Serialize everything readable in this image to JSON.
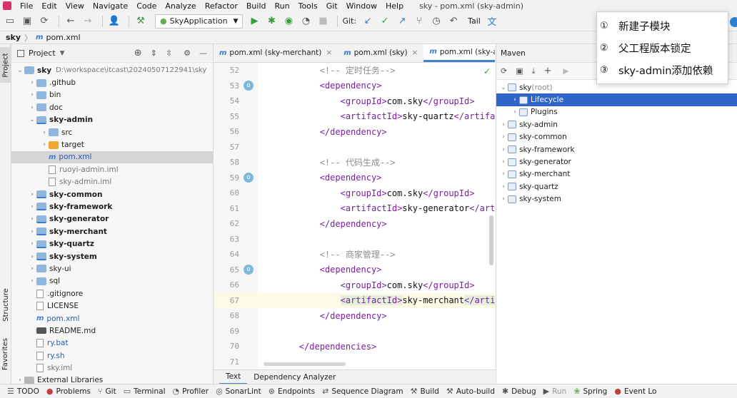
{
  "window": {
    "title": "sky - pom.xml (sky-admin)"
  },
  "menu": [
    "File",
    "Edit",
    "View",
    "Navigate",
    "Code",
    "Analyze",
    "Refactor",
    "Build",
    "Run",
    "Tools",
    "Git",
    "Window",
    "Help"
  ],
  "toolbar": {
    "run_config": "SkyApplication",
    "git_label": "Git:",
    "tail_label": "Tail"
  },
  "breadcrumb": {
    "project": "sky",
    "file": "pom.xml"
  },
  "left_tabs": {
    "project": "Project",
    "structure": "Structure",
    "favorites": "Favorites"
  },
  "project_panel": {
    "title": "Project",
    "root": {
      "name": "sky",
      "path": "D:\\workspace\\itcast\\20240507122941\\sky"
    },
    "items": [
      {
        "label": ".github",
        "type": "folder",
        "depth": 1,
        "expand": "closed"
      },
      {
        "label": "bin",
        "type": "folder",
        "depth": 1,
        "expand": "closed"
      },
      {
        "label": "doc",
        "type": "folder",
        "depth": 1,
        "expand": "closed"
      },
      {
        "label": "sky-admin",
        "type": "module",
        "depth": 1,
        "expand": "open",
        "bold": true
      },
      {
        "label": "src",
        "type": "folder",
        "depth": 2,
        "expand": "closed"
      },
      {
        "label": "target",
        "type": "folder-orange",
        "depth": 2,
        "expand": "closed"
      },
      {
        "label": "pom.xml",
        "type": "maven",
        "depth": 2,
        "expand": "none",
        "selected": true
      },
      {
        "label": "ruoyi-admin.iml",
        "type": "file",
        "depth": 2,
        "expand": "none",
        "muted": true
      },
      {
        "label": "sky-admin.iml",
        "type": "file",
        "depth": 2,
        "expand": "none",
        "muted": true
      },
      {
        "label": "sky-common",
        "type": "module",
        "depth": 1,
        "expand": "closed",
        "bold": true
      },
      {
        "label": "sky-framework",
        "type": "module",
        "depth": 1,
        "expand": "closed",
        "bold": true
      },
      {
        "label": "sky-generator",
        "type": "module",
        "depth": 1,
        "expand": "closed",
        "bold": true
      },
      {
        "label": "sky-merchant",
        "type": "module",
        "depth": 1,
        "expand": "closed",
        "bold": true
      },
      {
        "label": "sky-quartz",
        "type": "module",
        "depth": 1,
        "expand": "closed",
        "bold": true
      },
      {
        "label": "sky-system",
        "type": "module",
        "depth": 1,
        "expand": "closed",
        "bold": true
      },
      {
        "label": "sky-ui",
        "type": "folder",
        "depth": 1,
        "expand": "closed"
      },
      {
        "label": "sql",
        "type": "folder",
        "depth": 1,
        "expand": "closed"
      },
      {
        "label": ".gitignore",
        "type": "file",
        "depth": 1,
        "expand": "none"
      },
      {
        "label": "LICENSE",
        "type": "file",
        "depth": 1,
        "expand": "none"
      },
      {
        "label": "pom.xml",
        "type": "maven",
        "depth": 1,
        "expand": "none"
      },
      {
        "label": "README.md",
        "type": "md",
        "depth": 1,
        "expand": "none"
      },
      {
        "label": "ry.bat",
        "type": "file",
        "depth": 1,
        "expand": "none",
        "blue": true
      },
      {
        "label": "ry.sh",
        "type": "file",
        "depth": 1,
        "expand": "none",
        "blue": true
      },
      {
        "label": "sky.iml",
        "type": "file",
        "depth": 1,
        "expand": "none",
        "muted": true
      },
      {
        "label": "External Libraries",
        "type": "lib",
        "depth": 0,
        "expand": "closed"
      }
    ]
  },
  "editor": {
    "tabs": [
      {
        "label": "pom.xml (sky-merchant)",
        "active": false
      },
      {
        "label": "pom.xml (sky)",
        "active": false
      },
      {
        "label": "pom.xml (sky-admin)",
        "active": true
      }
    ],
    "lines": [
      {
        "n": "52",
        "parts": [
          [
            "cm",
            "            <!-- 定时任务-->"
          ]
        ]
      },
      {
        "n": "53",
        "mark": true,
        "parts": [
          [
            "tx",
            "            "
          ],
          [
            "tg",
            "<dependency>"
          ]
        ]
      },
      {
        "n": "54",
        "parts": [
          [
            "tx",
            "                "
          ],
          [
            "tg",
            "<groupId>"
          ],
          [
            "tx",
            "com.sky"
          ],
          [
            "tg",
            "</groupId>"
          ]
        ]
      },
      {
        "n": "55",
        "parts": [
          [
            "tx",
            "                "
          ],
          [
            "tg",
            "<artifactId>"
          ],
          [
            "tx",
            "sky-quartz"
          ],
          [
            "tg",
            "</artifactId>"
          ]
        ]
      },
      {
        "n": "56",
        "parts": [
          [
            "tx",
            "            "
          ],
          [
            "tg",
            "</dependency>"
          ]
        ]
      },
      {
        "n": "57",
        "parts": []
      },
      {
        "n": "58",
        "parts": [
          [
            "cm",
            "            <!-- 代码生成-->"
          ]
        ]
      },
      {
        "n": "59",
        "mark": true,
        "parts": [
          [
            "tx",
            "            "
          ],
          [
            "tg",
            "<dependency>"
          ]
        ]
      },
      {
        "n": "60",
        "parts": [
          [
            "tx",
            "                "
          ],
          [
            "tg",
            "<groupId>"
          ],
          [
            "tx",
            "com.sky"
          ],
          [
            "tg",
            "</groupId>"
          ]
        ]
      },
      {
        "n": "61",
        "parts": [
          [
            "tx",
            "                "
          ],
          [
            "tg",
            "<artifactId>"
          ],
          [
            "tx",
            "sky-generator"
          ],
          [
            "tg",
            "</artifactId>"
          ]
        ]
      },
      {
        "n": "62",
        "parts": [
          [
            "tx",
            "            "
          ],
          [
            "tg",
            "</dependency>"
          ]
        ]
      },
      {
        "n": "63",
        "parts": []
      },
      {
        "n": "64",
        "parts": [
          [
            "cm",
            "            <!-- 商家管理-->"
          ]
        ]
      },
      {
        "n": "65",
        "mark": true,
        "parts": [
          [
            "tx",
            "            "
          ],
          [
            "tg",
            "<dependency>"
          ]
        ]
      },
      {
        "n": "66",
        "parts": [
          [
            "tx",
            "                "
          ],
          [
            "tg",
            "<groupId>"
          ],
          [
            "tx",
            "com.sky"
          ],
          [
            "tg",
            "</groupId>"
          ]
        ]
      },
      {
        "n": "67",
        "hl": true,
        "parts": [
          [
            "tx",
            "                "
          ],
          [
            "tg",
            "<artifactId>"
          ],
          [
            "tx",
            "sky-merchant"
          ],
          [
            "tg",
            "</artifactId>"
          ]
        ]
      },
      {
        "n": "68",
        "parts": [
          [
            "tx",
            "            "
          ],
          [
            "tg",
            "</dependency>"
          ]
        ]
      },
      {
        "n": "69",
        "parts": []
      },
      {
        "n": "70",
        "parts": [
          [
            "tx",
            "        "
          ],
          [
            "tg",
            "</dependencies>"
          ]
        ]
      },
      {
        "n": "71",
        "parts": []
      }
    ],
    "bottom_tabs": [
      "Text",
      "Dependency Analyzer"
    ]
  },
  "maven": {
    "title": "Maven",
    "tree": [
      {
        "label": "sky",
        "suffix": " (root)",
        "depth": 0,
        "expand": "open",
        "kind": "module"
      },
      {
        "label": "Lifecycle",
        "depth": 1,
        "expand": "closed",
        "kind": "folder",
        "selected": true
      },
      {
        "label": "Plugins",
        "depth": 1,
        "expand": "closed",
        "kind": "folder"
      },
      {
        "label": "sky-admin",
        "depth": 0,
        "expand": "closed",
        "kind": "module"
      },
      {
        "label": "sky-common",
        "depth": 0,
        "expand": "closed",
        "kind": "module"
      },
      {
        "label": "sky-framework",
        "depth": 0,
        "expand": "closed",
        "kind": "module"
      },
      {
        "label": "sky-generator",
        "depth": 0,
        "expand": "closed",
        "kind": "module"
      },
      {
        "label": "sky-merchant",
        "depth": 0,
        "expand": "closed",
        "kind": "module"
      },
      {
        "label": "sky-quartz",
        "depth": 0,
        "expand": "closed",
        "kind": "module"
      },
      {
        "label": "sky-system",
        "depth": 0,
        "expand": "closed",
        "kind": "module"
      }
    ]
  },
  "popup": {
    "items": [
      {
        "num": "①",
        "label": "新建子模块"
      },
      {
        "num": "②",
        "label": "父工程版本锁定"
      },
      {
        "num": "③",
        "label": "sky-admin添加依赖"
      }
    ]
  },
  "statusbar": [
    "TODO",
    "Problems",
    "Git",
    "Terminal",
    "Profiler",
    "SonarLint",
    "Endpoints",
    "Sequence Diagram",
    "Build",
    "Auto-build",
    "Debug",
    "Run",
    "Spring",
    "Event Lo"
  ],
  "colors": {
    "accent": "#4083c9",
    "selection": "#2f65ca",
    "tag": "#7a1fa2",
    "comment": "#8c8c8c"
  }
}
